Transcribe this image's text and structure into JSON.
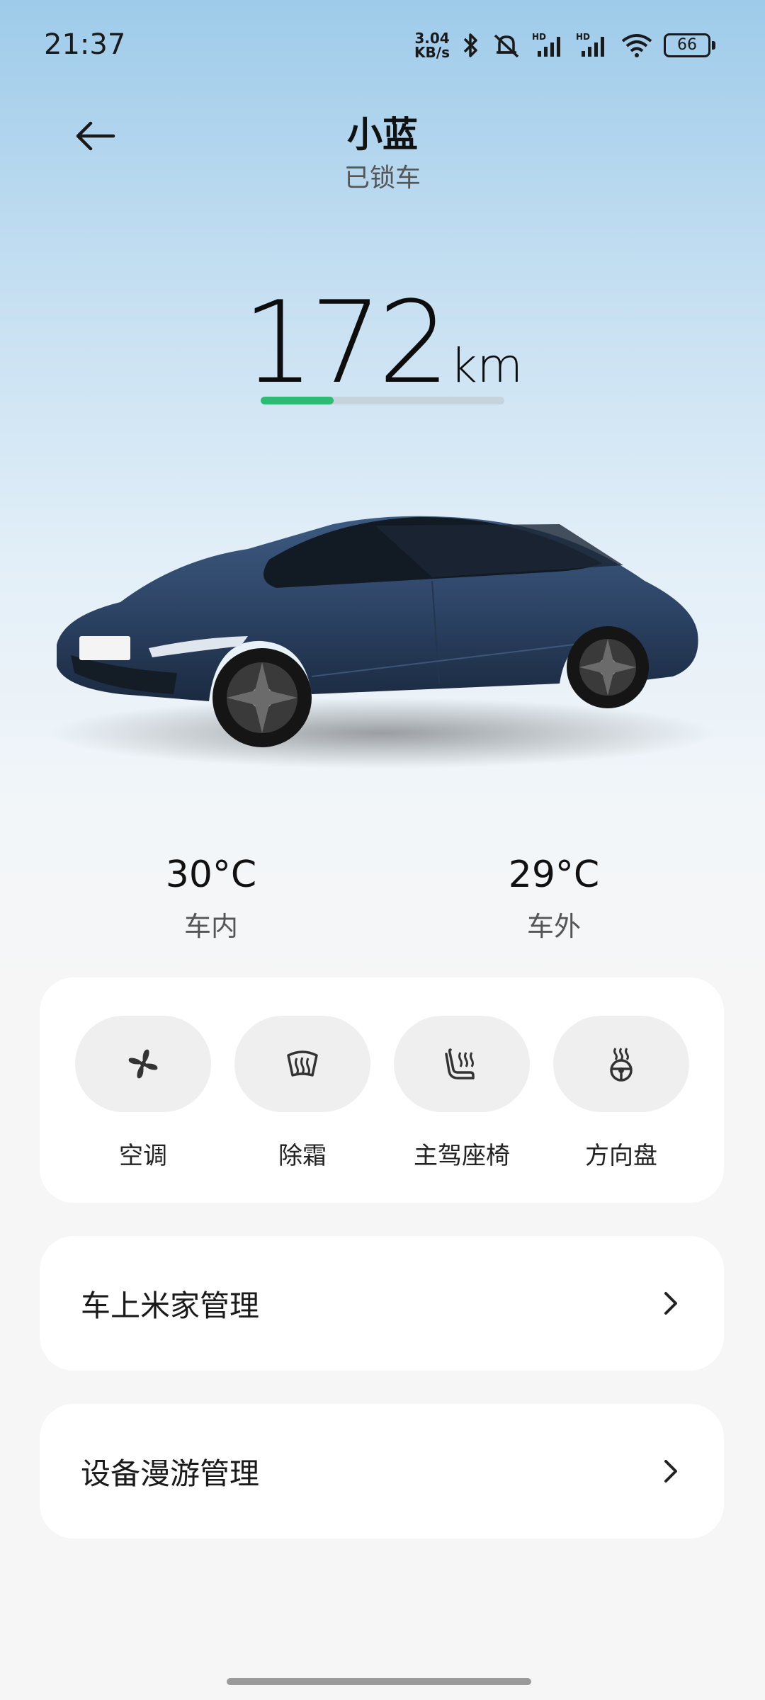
{
  "status_bar": {
    "time": "21:37",
    "net_speed_value": "3.04",
    "net_speed_unit": "KB/s",
    "battery": "66",
    "icons": [
      "bluetooth-icon",
      "mute-icon",
      "signal-hd-icon",
      "signal-hd-icon",
      "wifi-icon",
      "battery-icon"
    ]
  },
  "header": {
    "title": "小蓝",
    "subtitle": "已锁车"
  },
  "range": {
    "value": "172",
    "unit": "km",
    "level_fraction": 0.3
  },
  "temperature": {
    "inside_value": "30°C",
    "inside_label": "车内",
    "outside_value": "29°C",
    "outside_label": "车外"
  },
  "controls": [
    {
      "label": "空调",
      "icon": "fan-icon"
    },
    {
      "label": "除霜",
      "icon": "defrost-icon"
    },
    {
      "label": "主驾座椅",
      "icon": "seat-heat-icon"
    },
    {
      "label": "方向盘",
      "icon": "steering-wheel-heat-icon"
    }
  ],
  "menu": {
    "mijia_label": "车上米家管理",
    "roaming_label": "设备漫游管理"
  },
  "colors": {
    "range_fill": "#2dbb74",
    "range_track": "#c5d3dd",
    "control_bg": "#efefef",
    "car_body": "#2d4466"
  }
}
